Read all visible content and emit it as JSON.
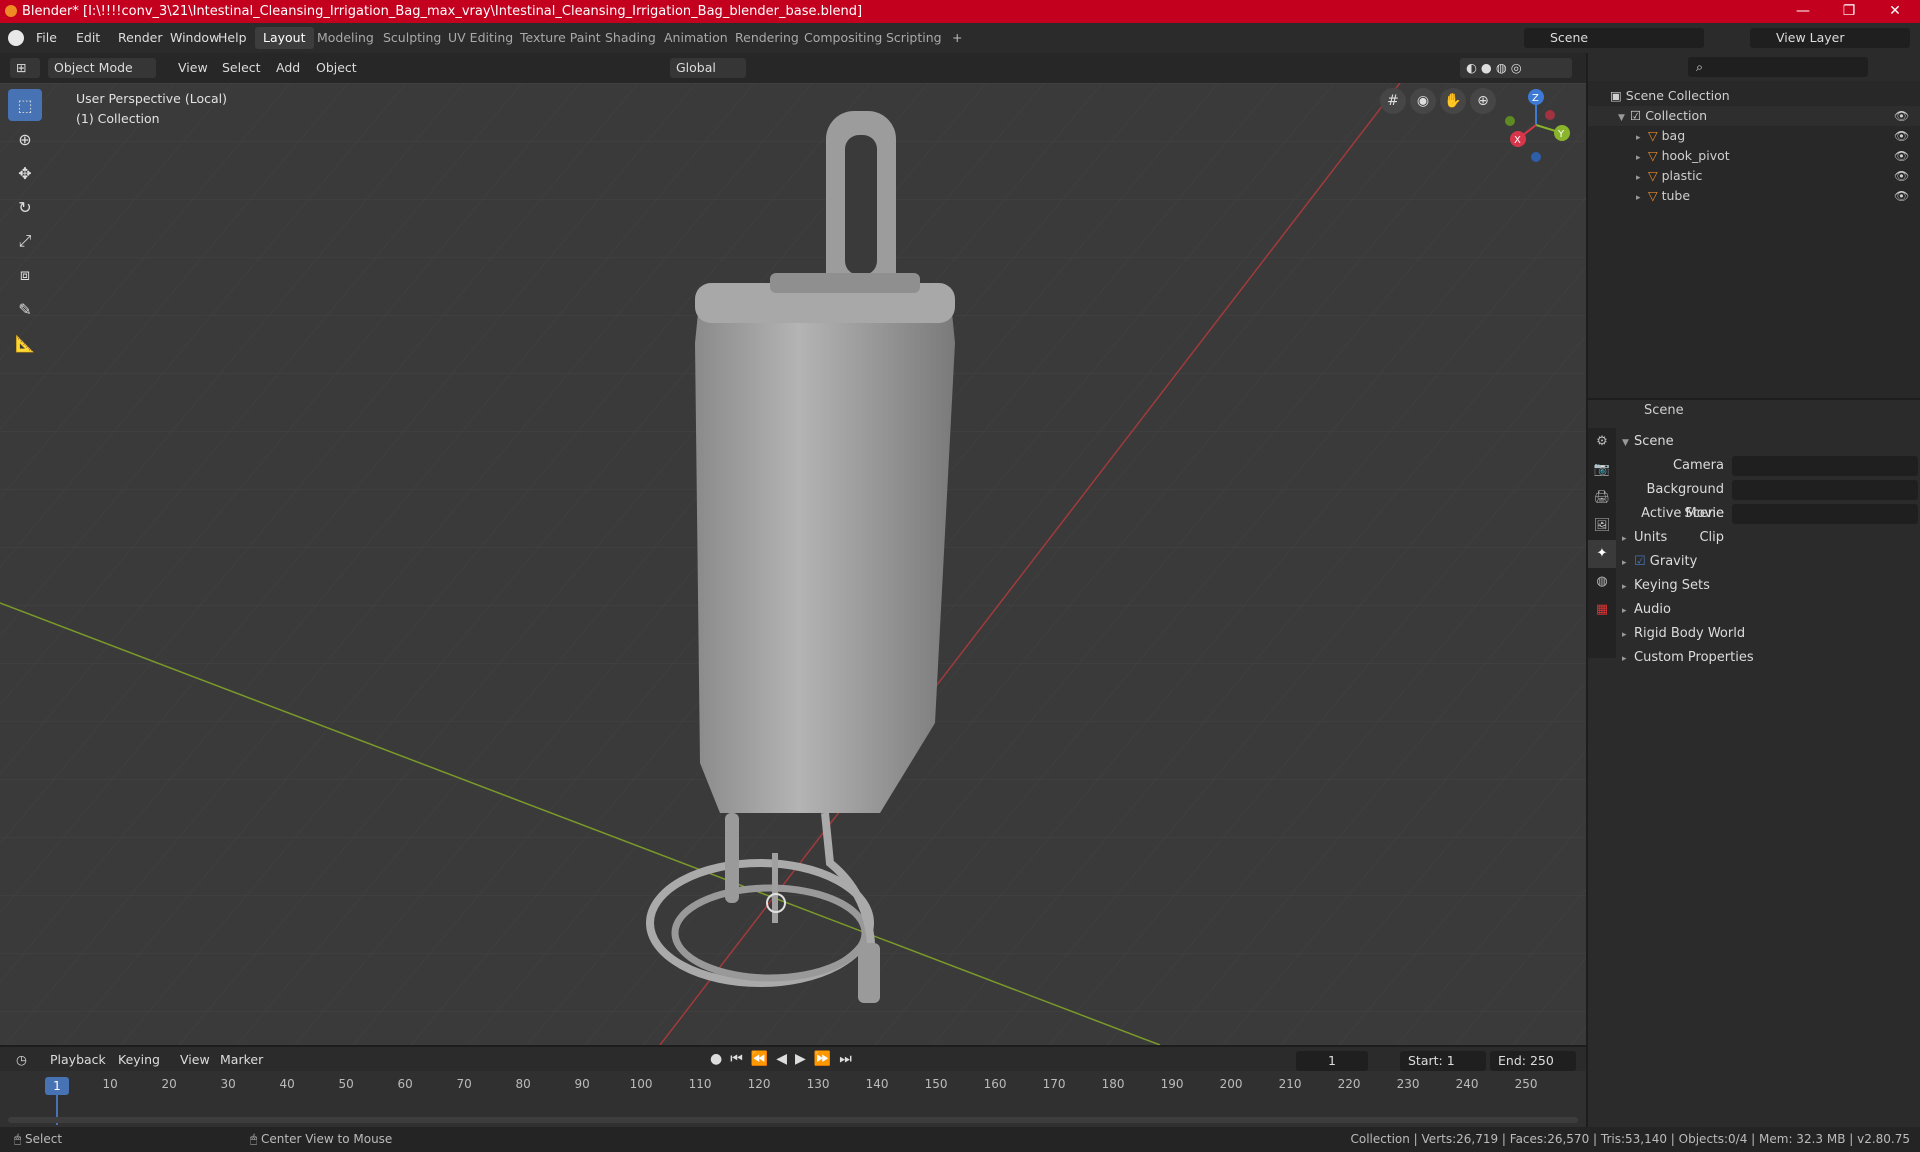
{
  "window": {
    "title": "Blender* [I:\\!!!!conv_3\\21\\Intestinal_Cleansing_Irrigation_Bag_max_vray\\Intestinal_Cleansing_Irrigation_Bag_blender_base.blend]",
    "minimize": "—",
    "maximize": "❐",
    "close": "✕"
  },
  "menu": {
    "file": "File",
    "edit": "Edit",
    "render": "Render",
    "window": "Window",
    "help": "Help"
  },
  "workspaces": [
    "Layout",
    "Modeling",
    "Sculpting",
    "UV Editing",
    "Texture Paint",
    "Shading",
    "Animation",
    "Rendering",
    "Compositing",
    "Scripting"
  ],
  "add_workspace": "+",
  "scene_field": "Scene",
  "view_layer_field": "View Layer",
  "viewport_header": {
    "mode": "Object Mode",
    "view": "View",
    "select": "Select",
    "add": "Add",
    "object": "Object",
    "orientation": "Global"
  },
  "viewport": {
    "perspective": "User Perspective (Local)",
    "collection": "(1) Collection",
    "axes": {
      "x": "X",
      "y": "Y",
      "z": "Z"
    }
  },
  "outliner": {
    "root": "Scene Collection",
    "collection": "Collection",
    "items": [
      "bag",
      "hook_pivot",
      "plastic",
      "tube"
    ]
  },
  "properties": {
    "header": "Scene",
    "panel": "Scene",
    "camera_label": "Camera",
    "background_label": "Background Scene",
    "movieclip_label": "Active Movie Clip",
    "sections": [
      "Units",
      "Gravity",
      "Keying Sets",
      "Audio",
      "Rigid Body World",
      "Custom Properties"
    ],
    "gravity_checked": true
  },
  "timeline": {
    "playback": "Playback",
    "keying": "Keying",
    "view": "View",
    "marker": "Marker",
    "current_frame": "1",
    "start_label": "Start:",
    "start": "1",
    "end_label": "End:",
    "end": "250",
    "ruler": [
      "1",
      "10",
      "20",
      "30",
      "40",
      "50",
      "60",
      "70",
      "80",
      "90",
      "100",
      "110",
      "120",
      "130",
      "140",
      "150",
      "160",
      "170",
      "180",
      "190",
      "200",
      "210",
      "220",
      "230",
      "240",
      "250"
    ]
  },
  "status": {
    "left1": "Select",
    "left2": "Center View to Mouse",
    "right": "Collection | Verts:26,719 | Faces:26,570 | Tris:53,140 | Objects:0/4 | Mem: 32.3 MB | v2.80.75"
  },
  "colors": {
    "accent": "#4772b3",
    "title": "#c4001f",
    "x_axis": "#d7364a",
    "y_axis": "#8ab42c",
    "z_axis": "#3d7ad6"
  }
}
